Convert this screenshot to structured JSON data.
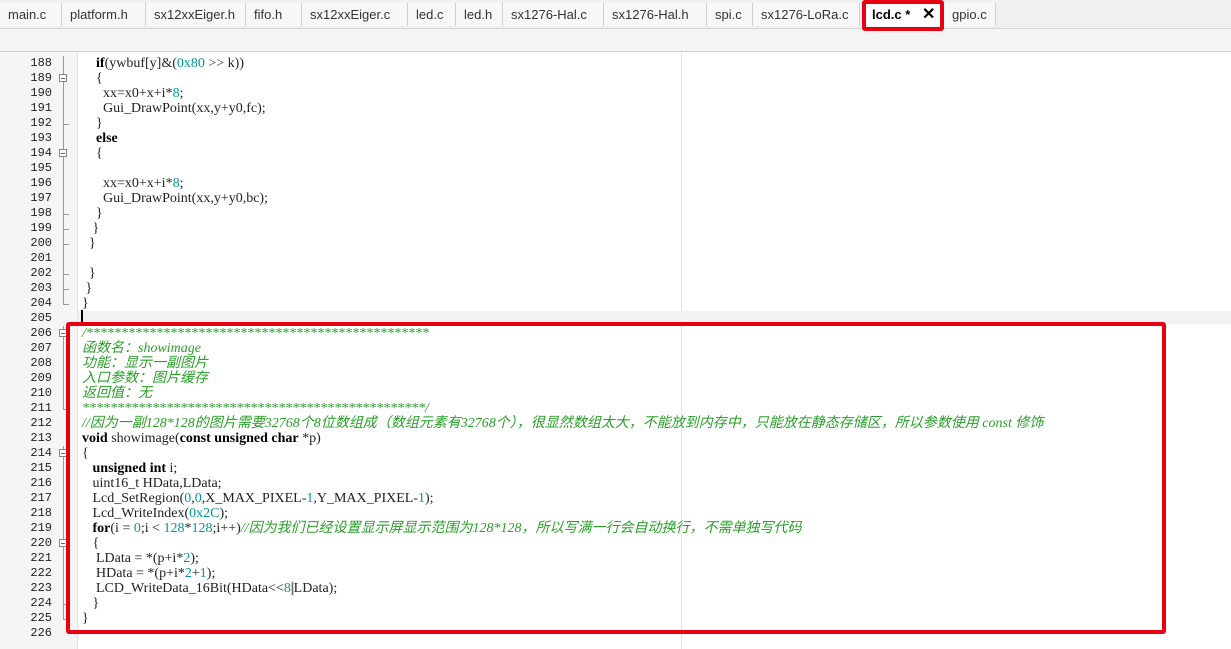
{
  "tabs": [
    {
      "label": "main.c"
    },
    {
      "label": "platform.h"
    },
    {
      "label": "sx12xxEiger.h"
    },
    {
      "label": "fifo.h"
    },
    {
      "label": "sx12xxEiger.c"
    },
    {
      "label": "led.c"
    },
    {
      "label": "led.h"
    },
    {
      "label": "sx1276-Hal.c"
    },
    {
      "label": "sx1276-Hal.h"
    },
    {
      "label": "spi.c"
    },
    {
      "label": "sx1276-LoRa.c"
    },
    {
      "label": "lcd.c *",
      "active": true
    },
    {
      "label": "gpio.c"
    }
  ],
  "close_glyph": "✕",
  "lines": [
    {
      "n": "188",
      "code": [
        {
          "t": "    if",
          "k": "kw"
        },
        {
          "t": "(ywbuf[y]&("
        },
        {
          "t": "0x80",
          "k": "num"
        },
        {
          "t": " >> ",
          "k": "op"
        },
        {
          "t": "k))"
        }
      ]
    },
    {
      "n": "189",
      "code": [
        {
          "t": "    {"
        }
      ]
    },
    {
      "n": "190",
      "code": [
        {
          "t": "      xx=x0+x+i*"
        },
        {
          "t": "8",
          "k": "num"
        },
        {
          "t": ";"
        }
      ]
    },
    {
      "n": "191",
      "code": [
        {
          "t": "      Gui_DrawPoint(xx,y+y0,fc);"
        }
      ]
    },
    {
      "n": "192",
      "code": [
        {
          "t": "    }"
        }
      ]
    },
    {
      "n": "193",
      "code": [
        {
          "t": "    else",
          "k": "kw"
        }
      ]
    },
    {
      "n": "194",
      "code": [
        {
          "t": "    {"
        }
      ]
    },
    {
      "n": "195",
      "code": []
    },
    {
      "n": "196",
      "code": [
        {
          "t": "      xx=x0+x+i*"
        },
        {
          "t": "8",
          "k": "num"
        },
        {
          "t": ";"
        }
      ]
    },
    {
      "n": "197",
      "code": [
        {
          "t": "      Gui_DrawPoint(xx,y+y0,bc);"
        }
      ]
    },
    {
      "n": "198",
      "code": [
        {
          "t": "    }"
        }
      ]
    },
    {
      "n": "199",
      "code": [
        {
          "t": "   }"
        }
      ]
    },
    {
      "n": "200",
      "code": [
        {
          "t": "  }"
        }
      ]
    },
    {
      "n": "201",
      "code": []
    },
    {
      "n": "202",
      "code": [
        {
          "t": "  }"
        }
      ]
    },
    {
      "n": "203",
      "code": [
        {
          "t": " }"
        }
      ]
    },
    {
      "n": "204",
      "code": [
        {
          "t": "}"
        }
      ]
    },
    {
      "n": "205",
      "code": []
    },
    {
      "n": "206",
      "code": [
        {
          "t": "/*************************************************",
          "k": "cm"
        }
      ]
    },
    {
      "n": "207",
      "code": [
        {
          "t": "函数名：showimage",
          "k": "cm"
        }
      ]
    },
    {
      "n": "208",
      "code": [
        {
          "t": "功能：显示一副图片",
          "k": "cm"
        }
      ]
    },
    {
      "n": "209",
      "code": [
        {
          "t": "入口参数：图片缓存",
          "k": "cm"
        }
      ]
    },
    {
      "n": "210",
      "code": [
        {
          "t": "返回值：无",
          "k": "cm"
        }
      ]
    },
    {
      "n": "211",
      "code": [
        {
          "t": "*************************************************/",
          "k": "cm"
        }
      ]
    },
    {
      "n": "212",
      "code": [
        {
          "t": "//因为一副128*128的图片需要32768个8位数组成（数组元素有32768个），很显然数组太大，不能放到内存中，只能放在静态存储区，所以参数使用 const 修饰",
          "k": "cm"
        }
      ]
    },
    {
      "n": "213",
      "code": [
        {
          "t": "void",
          "k": "kw"
        },
        {
          "t": " showimage("
        },
        {
          "t": "const unsigned char",
          "k": "kw"
        },
        {
          "t": " *p)"
        }
      ]
    },
    {
      "n": "214",
      "code": [
        {
          "t": "{"
        }
      ]
    },
    {
      "n": "215",
      "code": [
        {
          "t": "   "
        },
        {
          "t": "unsigned int",
          "k": "kw"
        },
        {
          "t": " i;"
        }
      ]
    },
    {
      "n": "216",
      "code": [
        {
          "t": "   uint16_t HData,LData;"
        }
      ]
    },
    {
      "n": "217",
      "code": [
        {
          "t": "   Lcd_SetRegion("
        },
        {
          "t": "0",
          "k": "num"
        },
        {
          "t": ","
        },
        {
          "t": "0",
          "k": "num"
        },
        {
          "t": ",X_MAX_PIXEL-"
        },
        {
          "t": "1",
          "k": "num"
        },
        {
          "t": ",Y_MAX_PIXEL-"
        },
        {
          "t": "1",
          "k": "num"
        },
        {
          "t": ");"
        }
      ]
    },
    {
      "n": "218",
      "code": [
        {
          "t": "   Lcd_WriteIndex("
        },
        {
          "t": "0x2C",
          "k": "num"
        },
        {
          "t": ");"
        }
      ]
    },
    {
      "n": "219",
      "code": [
        {
          "t": "   "
        },
        {
          "t": "for",
          "k": "kw"
        },
        {
          "t": "(i = "
        },
        {
          "t": "0",
          "k": "num"
        },
        {
          "t": ";i < "
        },
        {
          "t": "128",
          "k": "num"
        },
        {
          "t": "*"
        },
        {
          "t": "128",
          "k": "num"
        },
        {
          "t": ";i++)"
        },
        {
          "t": "//因为我们已经设置显示屏显示范围为128*128，所以写满一行会自动换行，不需单独写代码",
          "k": "cm"
        }
      ]
    },
    {
      "n": "220",
      "code": [
        {
          "t": "   {"
        }
      ]
    },
    {
      "n": "221",
      "code": [
        {
          "t": "    LData = *(p+i*"
        },
        {
          "t": "2",
          "k": "num"
        },
        {
          "t": ");"
        }
      ]
    },
    {
      "n": "222",
      "code": [
        {
          "t": "    HData = *(p+i*"
        },
        {
          "t": "2",
          "k": "num"
        },
        {
          "t": "+"
        },
        {
          "t": "1",
          "k": "num"
        },
        {
          "t": ");"
        }
      ]
    },
    {
      "n": "223",
      "code": [
        {
          "t": "    LCD_WriteData_16Bit(HData<<"
        },
        {
          "t": "8",
          "k": "num"
        },
        {
          "t": "|",
          "k": "hl"
        },
        {
          "t": "LData);"
        }
      ]
    },
    {
      "n": "224",
      "code": [
        {
          "t": "   }"
        }
      ]
    },
    {
      "n": "225",
      "code": [
        {
          "t": "}"
        }
      ]
    },
    {
      "n": "226",
      "code": []
    }
  ]
}
